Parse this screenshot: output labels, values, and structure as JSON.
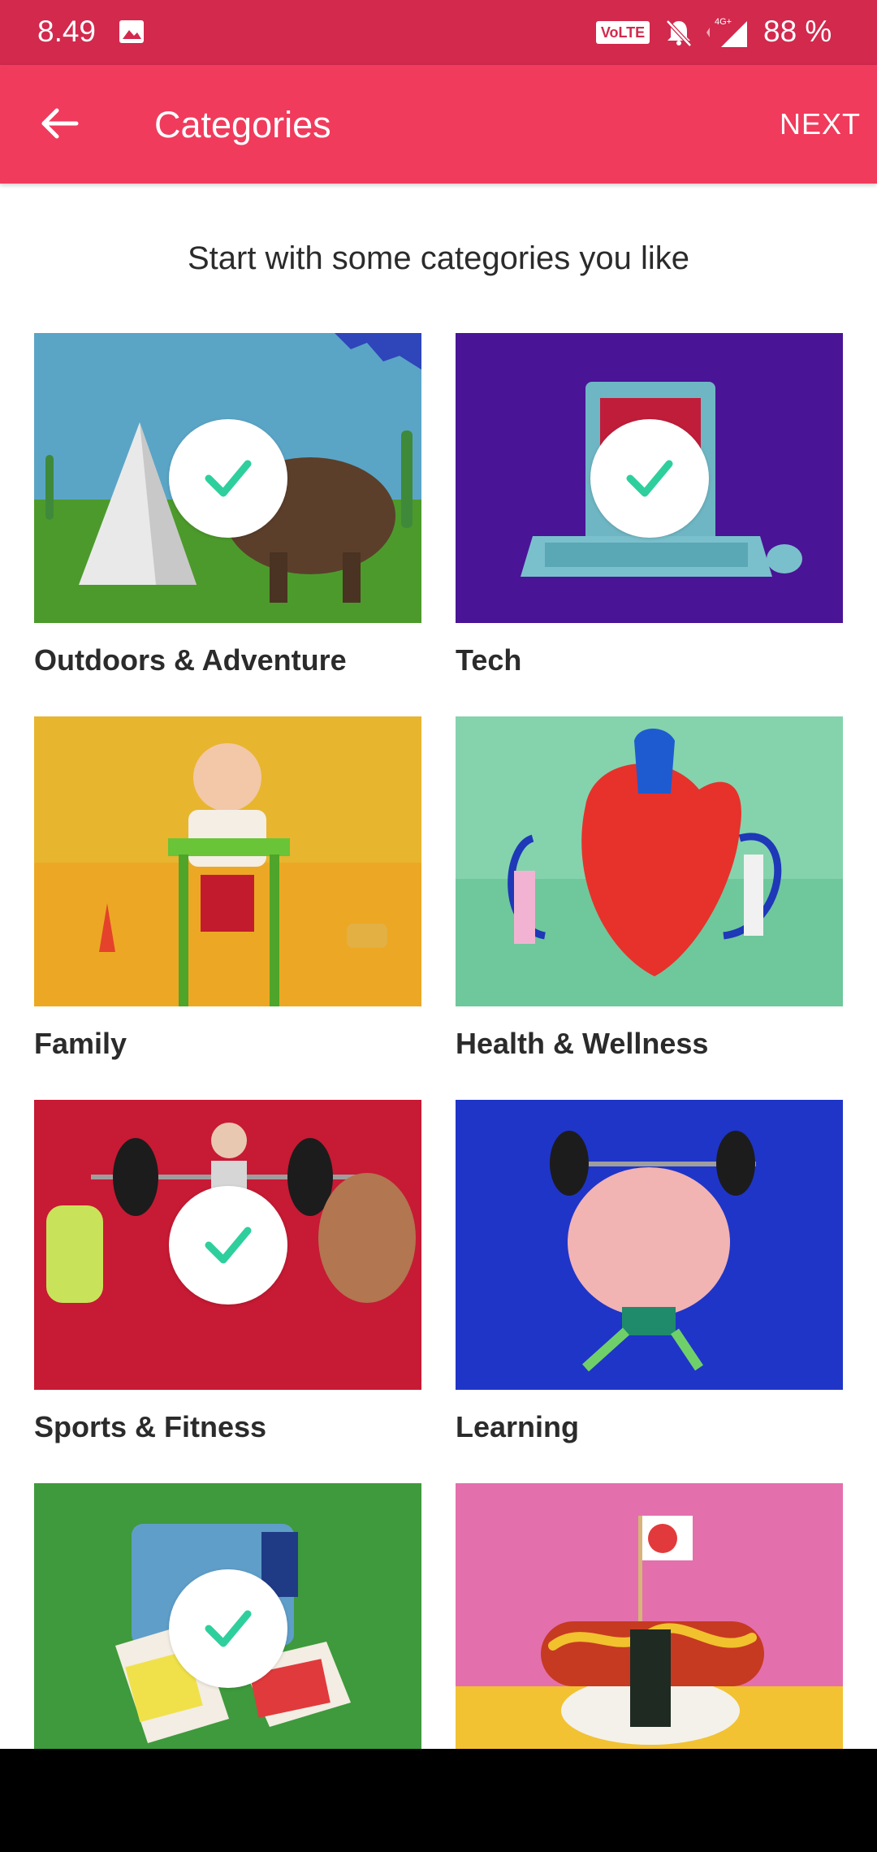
{
  "status_bar": {
    "time": "8.49",
    "volte": "VoLTE",
    "network": "4G+",
    "battery": "88 %"
  },
  "app_bar": {
    "title": "Categories",
    "next_label": "NEXT"
  },
  "subtitle": "Start with some categories you like",
  "categories": [
    {
      "label": "Outdoors & Adventure",
      "selected": true,
      "color": "#5aa5c6"
    },
    {
      "label": "Tech",
      "selected": true,
      "color": "#4a1496"
    },
    {
      "label": "Family",
      "selected": false,
      "color": "#eca824"
    },
    {
      "label": "Health & Wellness",
      "selected": false,
      "color": "#84d3ad"
    },
    {
      "label": "Sports & Fitness",
      "selected": true,
      "color": "#c71a34"
    },
    {
      "label": "Learning",
      "selected": false,
      "color": "#1f35c8"
    },
    {
      "label": "",
      "selected": true,
      "color": "#3e9a3c"
    },
    {
      "label": "",
      "selected": false,
      "color": "#e46fad"
    }
  ],
  "theme": {
    "status_bar": "#d2294d",
    "app_bar": "#f03b5c",
    "check_color": "#2ecf9d"
  }
}
